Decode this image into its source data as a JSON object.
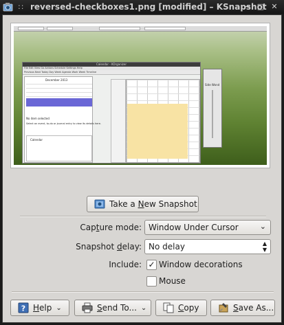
{
  "window": {
    "title": "reversed-checkboxes1.png [modified] – KSnapshot",
    "title_prefix": "::"
  },
  "preview": {
    "calendar_title": "Calendar - KOrganizer",
    "calendar_month": "December",
    "calendar_year": "2013",
    "no_item": "No item selected",
    "select_hint": "Select an event, to-do or journal entry to view its details here.",
    "calendar_item": "Calendar",
    "menu": "File  Edit  View  Go  Actions  Schedule  Settings  Help",
    "toolbar": "Previous   Next   Today   Day   Week   Agenda   Work Week   Timeline",
    "left_toolbar": "Day   Work Week   Week   Month",
    "side_label": "Side Wond"
  },
  "new_snapshot_button": {
    "label_pre": "Take a ",
    "label_u": "N",
    "label_post": "ew Snapshot"
  },
  "form": {
    "capture_mode_label_pre": "Cap",
    "capture_mode_label_u": "t",
    "capture_mode_label_post": "ure mode:",
    "capture_mode_value": "Window Under Cursor",
    "delay_label_pre": "Snapshot ",
    "delay_label_u": "d",
    "delay_label_post": "elay:",
    "delay_value": "No delay",
    "include_label": "Include:",
    "window_decorations_label": "Window decorations",
    "window_decorations_checked": true,
    "mouse_label": "Mouse",
    "mouse_checked": false
  },
  "bottom_buttons": {
    "help_pre": "",
    "help_u": "H",
    "help_post": "elp",
    "send_pre": "",
    "send_u": "S",
    "send_post": "end To...",
    "copy_pre": "",
    "copy_u": "C",
    "copy_post": "opy",
    "saveas_pre": "",
    "saveas_u": "S",
    "saveas_post": "ave As..."
  },
  "colors": {
    "window_bg": "#d8d6d3",
    "titlebar": "#1c1c1c",
    "check_mark": "#1e1e1e"
  },
  "icons": {
    "title": "ksnapshot-icon",
    "new_snapshot": "camera-icon",
    "help": "help-book-icon",
    "send": "printer-icon",
    "copy": "copy-icon",
    "saveas": "save-icon"
  }
}
